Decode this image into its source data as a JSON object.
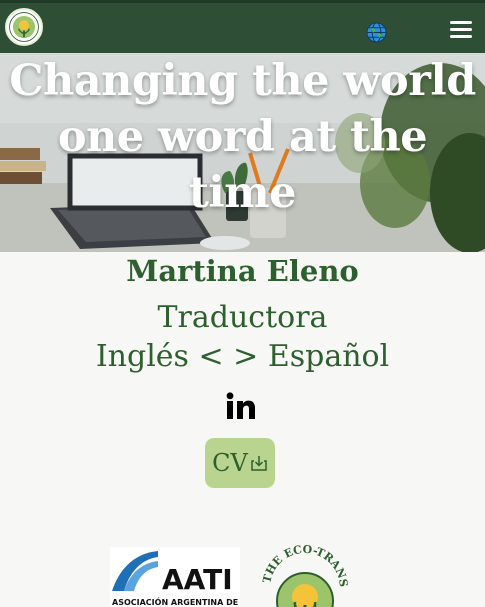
{
  "header": {
    "logo_icon": "eco-translator-logo",
    "language_icon": "globe-icon",
    "menu_icon": "hamburger-menu-icon",
    "colors": {
      "bar": "#2e4f36",
      "accent": "#b9d48f",
      "text": "#2e5f2e"
    }
  },
  "hero": {
    "title_line1": "Changing the world",
    "title_line2": "one word at the time"
  },
  "profile": {
    "name": "Martina Eleno",
    "role": "Traductora",
    "languages": "Inglés <  > Español",
    "social_icon": "linkedin-icon",
    "cv_label": "CV",
    "cv_icon": "download-icon"
  },
  "badges": {
    "aati_text": "AATI",
    "aati_subtext": "ASOCIACIÓN ARGENTINA DE",
    "eco_logo_text": "THE ECO-TRANSLATOR"
  }
}
